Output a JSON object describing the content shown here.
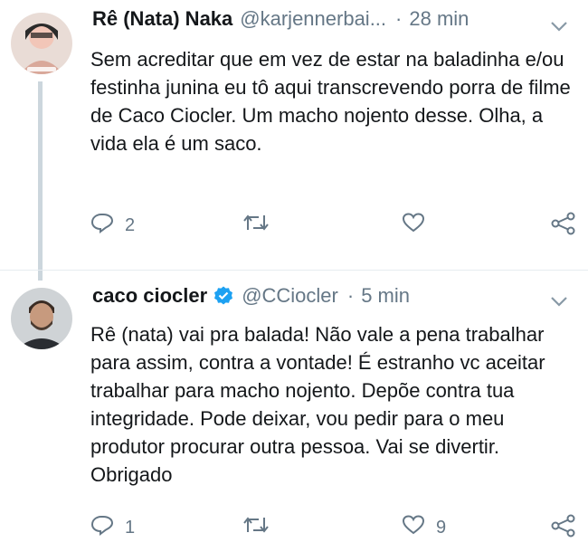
{
  "colors": {
    "text": "#14171a",
    "secondary": "#657786",
    "verified": "#1da1f2",
    "thread": "#ccd6dd"
  },
  "tweets": [
    {
      "name": "Rê (Nata) Naka",
      "handle": "@karjennerbai...",
      "time": "28 min",
      "text": "Sem acreditar que em vez de estar na baladinha e/ou festinha junina eu tô aqui transcrevendo porra de filme de Caco Ciocler. Um macho nojento desse. Olha, a vida ela é um saco.",
      "verified": false,
      "replies": "2",
      "retweets": "",
      "likes": "",
      "avatar_icon": "user-avatar-photo"
    },
    {
      "name": "caco ciocler",
      "handle": "@CCiocler",
      "time": "5 min",
      "text": "Rê (nata) vai pra balada! Não vale a pena trabalhar para assim, contra a vontade! É estranho vc aceitar trabalhar para macho nojento. Depõe contra tua integridade. Pode deixar, vou pedir para o meu produtor procurar outra pessoa. Vai se divertir. Obrigado",
      "verified": true,
      "replies": "1",
      "retweets": "",
      "likes": "9",
      "avatar_icon": "user-avatar-photo"
    }
  ],
  "sep": "·",
  "icons": {
    "reply": "reply-icon",
    "retweet": "retweet-icon",
    "like": "heart-icon",
    "share": "share-icon",
    "menu": "chevron-down-icon",
    "verified": "verified-badge-icon"
  }
}
